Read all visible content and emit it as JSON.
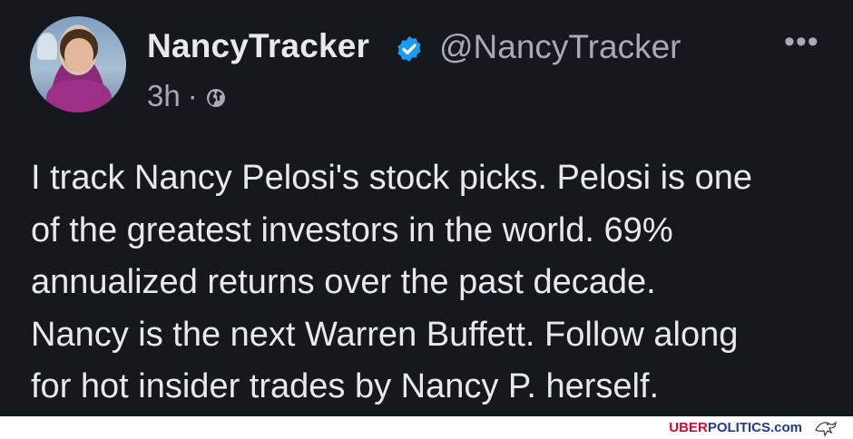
{
  "tweet": {
    "display_name": "NancyTracker",
    "handle": "@NancyTracker",
    "time": "3h",
    "separator": "·",
    "more_label": "•••",
    "text": "I track Nancy Pelosi's stock picks. Pelosi is one\nof the greatest investors in the world. 69%\nannualized returns over the past decade.\nNancy is the next Warren Buffett. Follow along\nfor hot insider trades by Nancy P. herself.",
    "icons": {
      "verified": "verified-badge-icon",
      "globe": "globe-icon",
      "more": "more-options-icon"
    }
  },
  "footer": {
    "brand_uber": "UBER",
    "brand_politics": "POLITICS.com"
  },
  "colors": {
    "background": "#15181c",
    "text": "#e7e9ea",
    "muted": "#a6abb1",
    "verified": "#1d9bf0",
    "brand_red": "#c8102e",
    "brand_blue": "#1f3b8f"
  }
}
